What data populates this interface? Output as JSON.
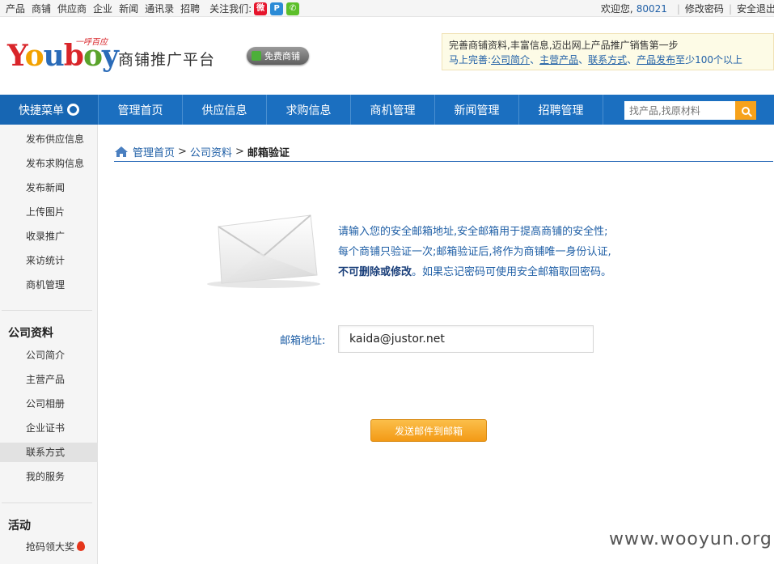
{
  "topbar": {
    "links": [
      "产品",
      "商铺",
      "供应商",
      "企业",
      "新闻",
      "通讯录",
      "招聘"
    ],
    "follow_label": "关注我们:",
    "social_icons": [
      "weibo-icon",
      "qzone-icon",
      "wechat-icon"
    ],
    "welcome": "欢迎您,",
    "user_id": "80021",
    "change_password": "修改密码",
    "logout": "安全退出"
  },
  "header": {
    "logo_text": "Youboy",
    "logo_tagline": "一呼百应",
    "platform_title": "商铺推广平台",
    "free_badge": "免费商铺"
  },
  "notice": {
    "line1": "完善商铺资料,丰富信息,迈出网上产品推广销售第一步",
    "line2_prefix": "马上完善:",
    "links": [
      "公司简介",
      "主营产品",
      "联系方式",
      "产品发布"
    ],
    "separator": "、",
    "line2_suffix": "至少100个以上"
  },
  "nav": {
    "quick_menu": "快捷菜单",
    "items": [
      "管理首页",
      "供应信息",
      "求购信息",
      "商机管理",
      "新闻管理",
      "招聘管理"
    ],
    "search_placeholder": "找产品,找原材料"
  },
  "sidebar": {
    "quick_items": [
      "发布供应信息",
      "发布求购信息",
      "发布新闻",
      "上传图片",
      "收录推广",
      "来访统计",
      "商机管理"
    ],
    "company_section": "公司资料",
    "company_items": [
      "公司简介",
      "主营产品",
      "公司相册",
      "企业证书",
      "联系方式",
      "我的服务"
    ],
    "active_item": "联系方式",
    "activity_section": "活动",
    "activity_items": [
      "抢码领大奖"
    ]
  },
  "breadcrumb": {
    "home": "管理首页",
    "parent": "公司资料",
    "current": "邮箱验证",
    "separator": ">"
  },
  "main": {
    "intro_line1": "请输入您的安全邮箱地址,安全邮箱用于提高商铺的安全性;",
    "intro_line2": "每个商铺只验证一次;邮箱验证后,将作为商铺唯一身份认证,",
    "intro_line3_bold": "不可删除或修改",
    "intro_line3_rest": "。如果忘记密码可使用安全邮箱取回密码。",
    "email_label": "邮箱地址:",
    "email_value": "kaida@justor.net",
    "send_button": "发送邮件到邮箱"
  },
  "watermark": "www.wooyun.org",
  "colors": {
    "nav_blue": "#1b6fc0",
    "link_blue": "#1f5fa6",
    "button_orange": "#f39a16"
  }
}
